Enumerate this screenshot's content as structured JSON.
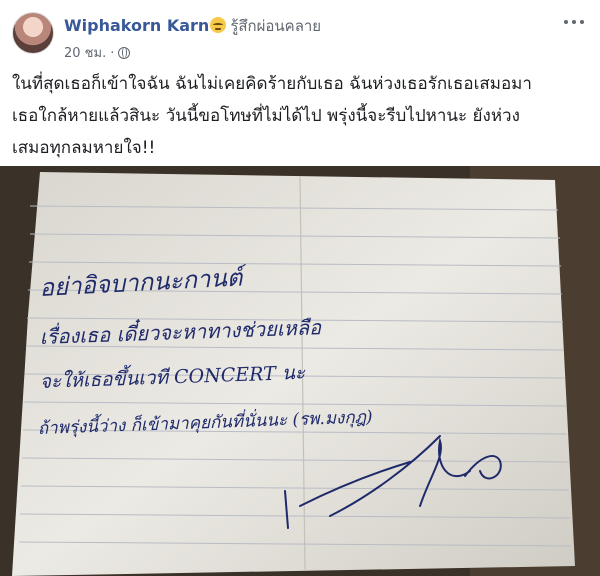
{
  "post": {
    "author_name": "Wiphakorn Karn",
    "feeling_emoji": "relieved-face-emoji",
    "feeling_text": "รู้สึกผ่อนคลาย",
    "timestamp": "20 ชม.",
    "privacy_icon": "globe-icon",
    "text_lines": [
      "ในที่สุดเธอก็เข้าใจฉัน ฉันไม่เคยคิดร้ายกับเธอ ฉันห่วงเธอรักเธอเสมอมา",
      "เธอใกล้หายแล้วสินะ วันนี้ขอโทษที่ไม่ได้ไป พรุ่งนี้จะรีบไปหานะ ยังห่วง",
      "เสมอทุกลมหายใจ!!"
    ]
  },
  "photo": {
    "note_lines": [
      "อย่าอิจบากนะกานต์",
      "เรื่องเธอ    เดี๋ยวจะหาทางช่วยเหลือ",
      "จะให้เธอขึ้นเวที CONCERT นะ",
      "ถ้าพรุ่งนี้ว่าง ก็เข้ามาคุยกันที่นั่นนะ (รพ.มงกุฎ)"
    ],
    "colors": {
      "paper": "#e9e6df",
      "ink": "#1f2a6b",
      "line": "#b9bcc6"
    }
  }
}
